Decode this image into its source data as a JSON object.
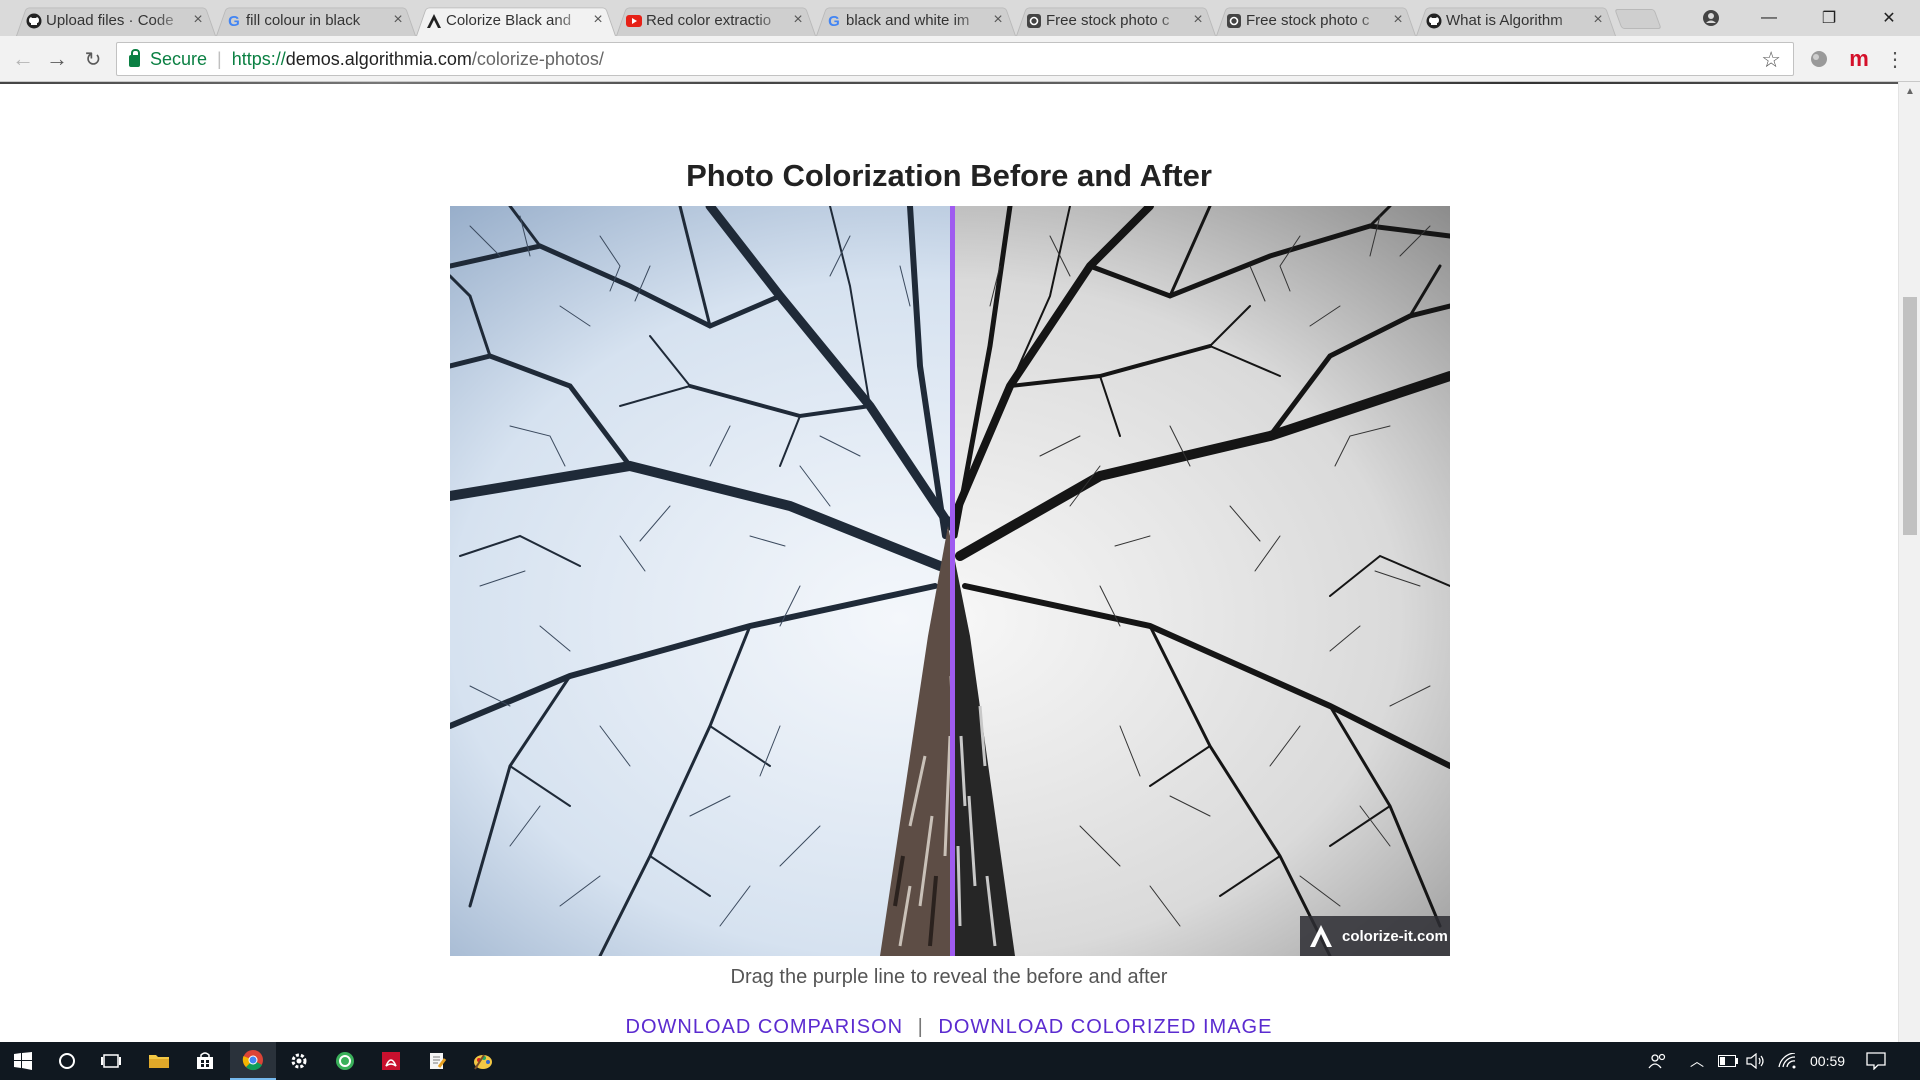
{
  "browser": {
    "tabs": [
      {
        "title": "Upload files · Code",
        "icon": "github-icon",
        "active": false
      },
      {
        "title": "fill colour in black",
        "icon": "google-icon",
        "active": false
      },
      {
        "title": "Colorize Black and",
        "icon": "algorithmia-icon",
        "active": true
      },
      {
        "title": "Red color extractio",
        "icon": "youtube-icon",
        "active": false
      },
      {
        "title": "black and white im",
        "icon": "google-icon",
        "active": false
      },
      {
        "title": "Free stock photo c",
        "icon": "camera-icon",
        "active": false
      },
      {
        "title": "Free stock photo c",
        "icon": "camera-icon",
        "active": false
      },
      {
        "title": "What is Algorithm",
        "icon": "github-icon",
        "active": false
      }
    ],
    "address": {
      "secure_label": "Secure",
      "scheme": "https://",
      "host": "demos.algorithmia.com",
      "path": "/colorize-photos/"
    },
    "window_controls": {
      "minimize": "—",
      "maximize": "❐",
      "close": "✕"
    }
  },
  "page": {
    "heading": "Photo Colorization Before and After",
    "badge_text": "colorize-it.com",
    "caption": "Drag the purple line to reveal the before and after",
    "download_comparison": "DOWNLOAD COMPARISON",
    "separator": "|",
    "download_colorized": "DOWNLOAD COLORIZED IMAGE",
    "divider_color": "#9f5bf0",
    "link_color": "#5b2bd0",
    "divider_position": 0.5
  },
  "taskbar": {
    "items": [
      "start-icon",
      "cortana-icon",
      "task-view-icon",
      "file-explorer-icon",
      "store-icon",
      "chrome-icon",
      "settings-icon",
      "app-green-icon",
      "acrobat-icon",
      "notepad-icon",
      "paint-icon"
    ],
    "clock": "00:59"
  }
}
